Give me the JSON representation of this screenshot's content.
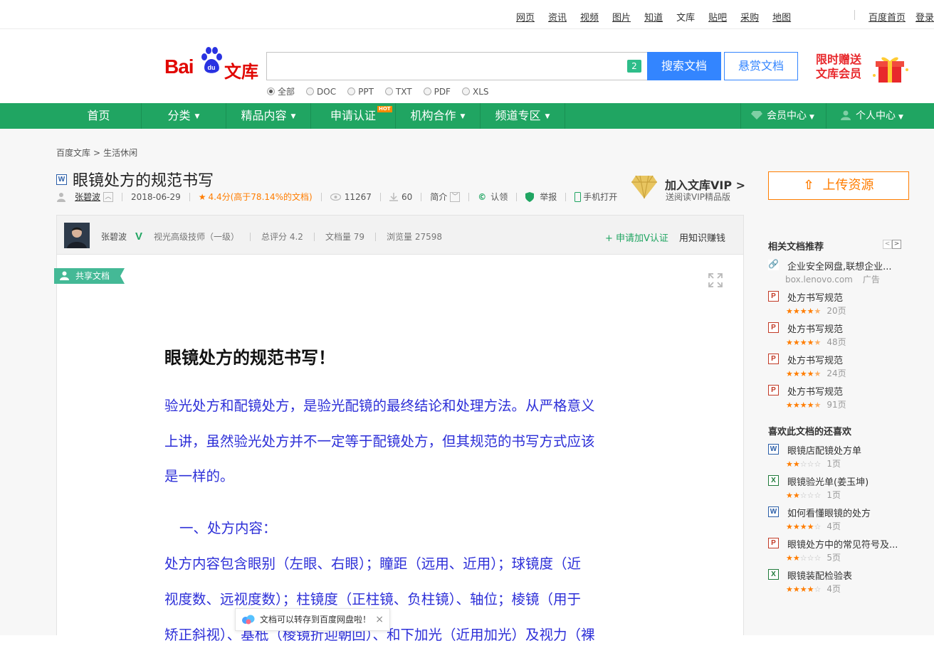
{
  "top_links": [
    "网页",
    "资讯",
    "视频",
    "图片",
    "知道",
    "文库",
    "贴吧",
    "采购",
    "地图"
  ],
  "top_right_links": [
    "百度首页",
    "登录"
  ],
  "logo": {
    "brand": "Bai",
    "paw_text": "du",
    "product": "文库"
  },
  "search": {
    "value": "",
    "badge": "2",
    "search_button": "搜索文档",
    "reward_button": "悬赏文档"
  },
  "promo": {
    "line1": "限时赠送",
    "line2": "文库会员"
  },
  "file_types": [
    {
      "label": "全部",
      "selected": true
    },
    {
      "label": "DOC",
      "selected": false
    },
    {
      "label": "PPT",
      "selected": false
    },
    {
      "label": "TXT",
      "selected": false
    },
    {
      "label": "PDF",
      "selected": false
    },
    {
      "label": "XLS",
      "selected": false
    }
  ],
  "nav": {
    "items": [
      "首页",
      "分类",
      "精品内容",
      "申请认证",
      "机构合作",
      "频道专区"
    ],
    "hot_badge": "HOT",
    "member_center": "会员中心",
    "personal_center": "个人中心"
  },
  "breadcrumb": [
    "百度文库",
    "生活休闲"
  ],
  "doc": {
    "type_icon": "W",
    "title": "眼镜处方的规范书写",
    "author": "张碧波",
    "date": "2018-06-29",
    "rating": "4.4分(高于78.14%的文档)",
    "views": "11267",
    "downloads": "60",
    "intro": "简介",
    "claim": "认领",
    "report": "举报",
    "mobile_open": "手机打开"
  },
  "vip": {
    "title": "加入文库VIP",
    "arrow": ">",
    "subtitle": "送阅读VIP精品版"
  },
  "author_bar": {
    "name": "张碧波",
    "v_mark": "V",
    "job": "视光高级技师（一级）",
    "total_score": "总评分 4.2",
    "doc_count": "文档量 79",
    "view_count": "浏览量 27598",
    "apply_v": "+ 申请加V认证",
    "earn": "用知识赚钱"
  },
  "shared_tag": "共享文档",
  "content": {
    "heading": "眼镜处方的规范书写！",
    "lines": [
      "验光处方和配镜处方，是验光配镜的最终结论和处理方法。从严格意义",
      "上讲，虽然验光处方并不一定等于配镜处方，但其规范的书写方式应该",
      "是一样的。",
      "一、处方内容：",
      "处方内容包含眼别（左眼、右眼）；瞳距（远用、近用）；球镜度（近",
      "视度数、远视度数）；柱镜度（正柱镜、负柱镜）、轴位；棱镜（用于",
      "矫正斜视）、基柢（棱镜折迎朝回）、和下加光（近用加光）及视力（裸"
    ]
  },
  "toast": {
    "text": "文档可以转存到百度网盘啦！",
    "close": "×"
  },
  "sidebar": {
    "upload_button": "上传资源",
    "related_heading": "相关文档推荐",
    "related": [
      {
        "icon": "L",
        "title": "企业安全网盘,联想企业...",
        "source": "box.lenovo.com",
        "ad": "广告"
      },
      {
        "icon": "P",
        "title": "处方书写规范",
        "rating": 4.5,
        "pages": "20页"
      },
      {
        "icon": "P",
        "title": "处方书写规范",
        "rating": 4.5,
        "pages": "48页"
      },
      {
        "icon": "P",
        "title": "处方书写规范",
        "rating": 4.5,
        "pages": "24页"
      },
      {
        "icon": "P",
        "title": "处方书写规范",
        "rating": 4.5,
        "pages": "91页"
      }
    ],
    "also_like_heading": "喜欢此文档的还喜欢",
    "also_like": [
      {
        "icon": "W",
        "title": "眼镜店配镜处方单",
        "rating": 2,
        "pages": "1页"
      },
      {
        "icon": "X",
        "title": "眼镜验光单(姜玉坤)",
        "rating": 2,
        "pages": "1页"
      },
      {
        "icon": "W",
        "title": "如何看懂眼镜的处方",
        "rating": 4,
        "pages": "4页"
      },
      {
        "icon": "P",
        "title": "眼镜处方中的常见符号及...",
        "rating": 2,
        "pages": "5页"
      },
      {
        "icon": "X",
        "title": "眼镜装配检验表",
        "rating": 4,
        "pages": "4页"
      }
    ]
  },
  "colors": {
    "nav_green": "#20a562",
    "search_blue": "#3385ff",
    "baidu_red": "#e10601",
    "orange": "#ff7d00",
    "content_blue": "#2d2fd8"
  }
}
